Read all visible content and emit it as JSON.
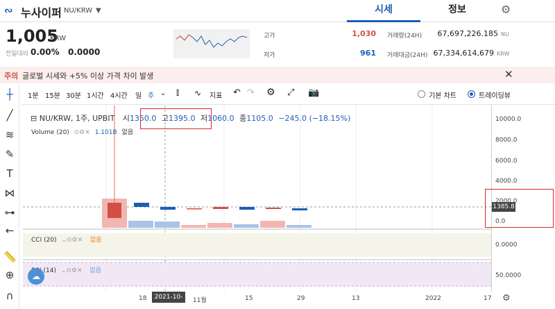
{
  "header": {
    "logo_glyph": "∾",
    "coin_name": "누사이퍼",
    "pair": "NU/KRW",
    "tabs": [
      "시세",
      "정보"
    ]
  },
  "price": {
    "value": "1,005",
    "unit": "KRW",
    "change_label": "전일대비",
    "change_pct": "0.00%",
    "change_val": "0.0000"
  },
  "stats": {
    "high_label": "고가",
    "high": "1,030",
    "low_label": "저가",
    "low": "961",
    "vol_label": "거래량(24H)",
    "vol": "67,697,226.185",
    "vol_unit": "NU",
    "amt_label": "거래대금(24H)",
    "amt": "67,334,614,679",
    "amt_unit": "KRW"
  },
  "notice": {
    "tag": "주의",
    "text": "글로벌 시세와 +5% 이상 가격 차이 발생"
  },
  "toolbar": {
    "intervals": [
      "1분",
      "15분",
      "30분",
      "1시간",
      "4시간",
      "일",
      "주"
    ],
    "indicator": "지표",
    "basic_chart": "기본 차트",
    "tradingview": "트레이딩뷰"
  },
  "legend": {
    "symbol": "NU/KRW, 1주, UPBIT",
    "o_label": "시",
    "o": "1350.0",
    "h_label": "고",
    "h": "1395.0",
    "l_label": "저",
    "l": "1060.0",
    "c_label": "종",
    "c": "1105.0",
    "chg": "−245.0 (−18.15%)"
  },
  "volume": {
    "label": "Volume (20)",
    "value": "1.101B",
    "none": "없음"
  },
  "cci": {
    "label": "CCI (20)",
    "none": "없음"
  },
  "rsi": {
    "label": "RSI (14)",
    "none": "없음"
  },
  "axis": {
    "ticks": [
      "10000.0",
      "8000.0",
      "6000.0",
      "4000.0",
      "2000.0",
      "0.0"
    ],
    "price_tag": "1385.8",
    "cci_tick": "0.0000",
    "rsi_tick": "50.0000"
  },
  "time_axis": {
    "labels": [
      "18",
      "11월",
      "15",
      "29",
      "13",
      "2022",
      "17"
    ],
    "crosshair": "2021-10-25"
  },
  "colors": {
    "accent": "#1a5fb4",
    "up": "#d24f45",
    "down": "#1a5fb4"
  }
}
